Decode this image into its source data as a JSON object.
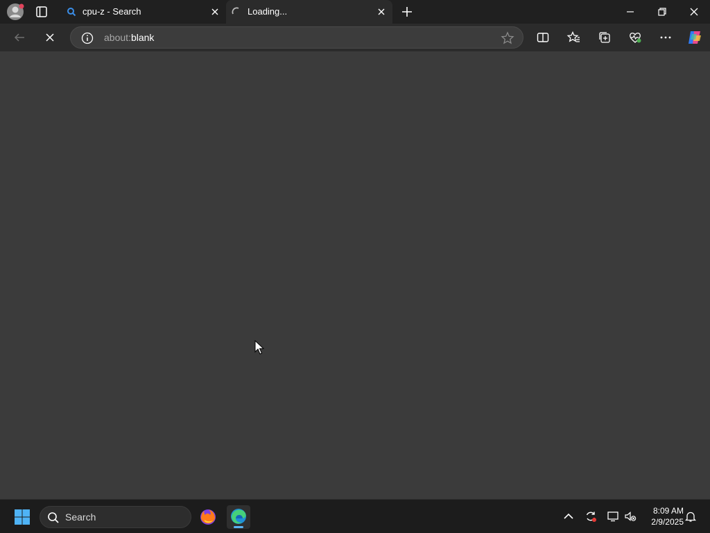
{
  "browser": {
    "tabs": [
      {
        "title": "cpu-z - Search",
        "favicon": "search-icon",
        "active": false
      },
      {
        "title": "Loading...",
        "favicon": "loading-spinner-icon",
        "active": true
      }
    ],
    "address_bar": {
      "url_prefix": "about:",
      "url_main": "blank"
    },
    "toolbar_icons": [
      "back-icon",
      "stop-icon",
      "split-screen-icon",
      "favorites-icon",
      "collections-icon",
      "browser-essentials-icon",
      "more-icon",
      "copilot-icon"
    ]
  },
  "taskbar": {
    "search_label": "Search",
    "apps": [
      "firefox-icon",
      "edge-icon"
    ],
    "clock": {
      "time": "8:09 AM",
      "date": "2/9/2025"
    }
  },
  "colors": {
    "tab_bar": "#202020",
    "toolbar": "#2b2b2b",
    "content": "#3b3b3b",
    "taskbar": "#1c1c1c",
    "accent": "#5ab4f5"
  }
}
